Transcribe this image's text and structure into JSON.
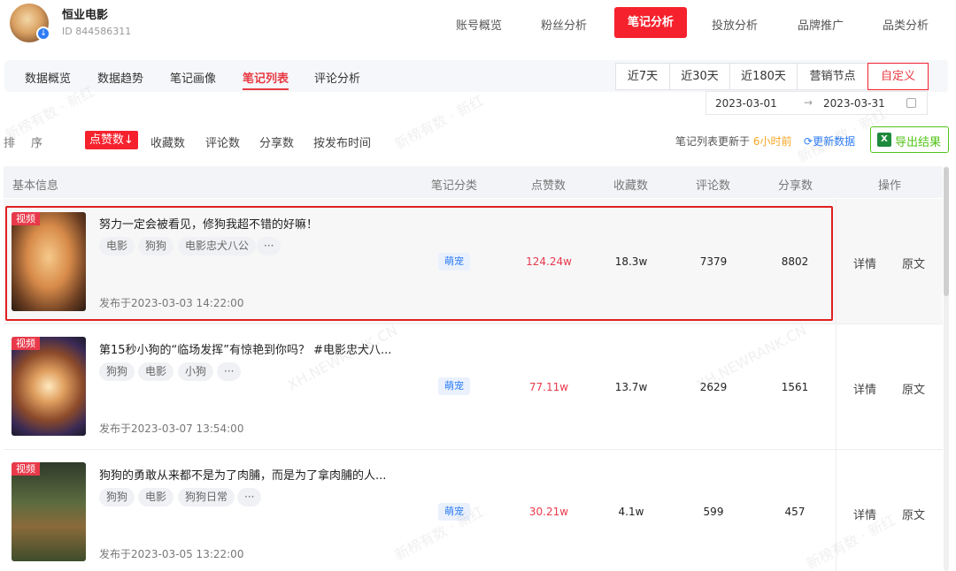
{
  "account": {
    "name": "恒业电影",
    "id": "ID 844586311"
  },
  "top_nav": [
    "账号概览",
    "粉丝分析",
    "笔记分析",
    "投放分析",
    "品牌推广",
    "品类分析"
  ],
  "sub_tabs": [
    "数据概览",
    "数据趋势",
    "笔记画像",
    "笔记列表",
    "评论分析"
  ],
  "ranges": [
    "近7天",
    "近30天",
    "近180天",
    "营销节点",
    "自定义"
  ],
  "date_range": {
    "start": "2023-03-01",
    "arrow": "→",
    "end": "2023-03-31"
  },
  "sort": {
    "label": "排序",
    "options": [
      "点赞数↓",
      "收藏数",
      "评论数",
      "分享数",
      "按发布时间"
    ]
  },
  "update": {
    "prefix": "笔记列表更新于 ",
    "time": "6小时前",
    "refresh": "更新数据",
    "export": "导出结果"
  },
  "columns": [
    "基本信息",
    "笔记分类",
    "点赞数",
    "收藏数",
    "评论数",
    "分享数",
    "操作"
  ],
  "rows": [
    {
      "badge": "视频",
      "title": "努力一定会被看见，修狗我超不错的好嘛！",
      "tags": [
        "电影",
        "狗狗",
        "电影忠犬八公",
        "···"
      ],
      "published": "发布于2023-03-03 14:22:00",
      "category": "萌宠",
      "likes": "124.24w",
      "favorites": "18.3w",
      "comments": "7379",
      "shares": "8802",
      "op_detail": "详情",
      "op_original": "原文"
    },
    {
      "badge": "视频",
      "title": "第15秒小狗的“临场发挥”有惊艳到你吗？ #电影忠犬八...",
      "tags": [
        "狗狗",
        "电影",
        "小狗",
        "···"
      ],
      "published": "发布于2023-03-07 13:54:00",
      "category": "萌宠",
      "likes": "77.11w",
      "favorites": "13.7w",
      "comments": "2629",
      "shares": "1561",
      "op_detail": "详情",
      "op_original": "原文"
    },
    {
      "badge": "视频",
      "title": "狗狗的勇敢从来都不是为了肉脯，而是为了拿肉脯的人...",
      "tags": [
        "狗狗",
        "电影",
        "狗狗日常",
        "···"
      ],
      "published": "发布于2023-03-05 13:22:00",
      "category": "萌宠",
      "likes": "30.21w",
      "favorites": "4.1w",
      "comments": "599",
      "shares": "457",
      "op_detail": "详情",
      "op_original": "原文"
    }
  ],
  "watermarks": [
    "新榜有数 · 新红",
    "XH.NEWRANK.CN"
  ]
}
